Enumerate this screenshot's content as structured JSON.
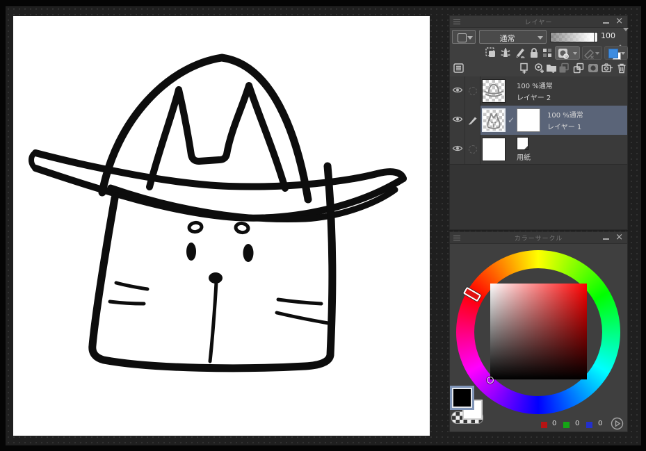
{
  "icons": {
    "close": "×",
    "check": "✓"
  },
  "canvas": {
    "subject": "black line drawing of a cat wearing a wide-brim hat"
  },
  "layers_panel": {
    "title": "レイヤー",
    "blend_mode": "通常",
    "opacity_value": "100",
    "rows": [
      {
        "info": "100 %通常",
        "name": "レイヤー 2"
      },
      {
        "info": "100 %通常",
        "name": "レイヤー 1"
      },
      {
        "info": "",
        "name": "用紙"
      }
    ]
  },
  "color_panel": {
    "title": "カラーサークル",
    "rgb": {
      "r": "0",
      "g": "0",
      "b": "0"
    },
    "foreground_color": "#000000",
    "background_color": "#ffffff",
    "selected_hue": "#ff0000"
  },
  "colors": {
    "accent_blue": "#3d8ce0",
    "selected_row": "#5a6478"
  }
}
